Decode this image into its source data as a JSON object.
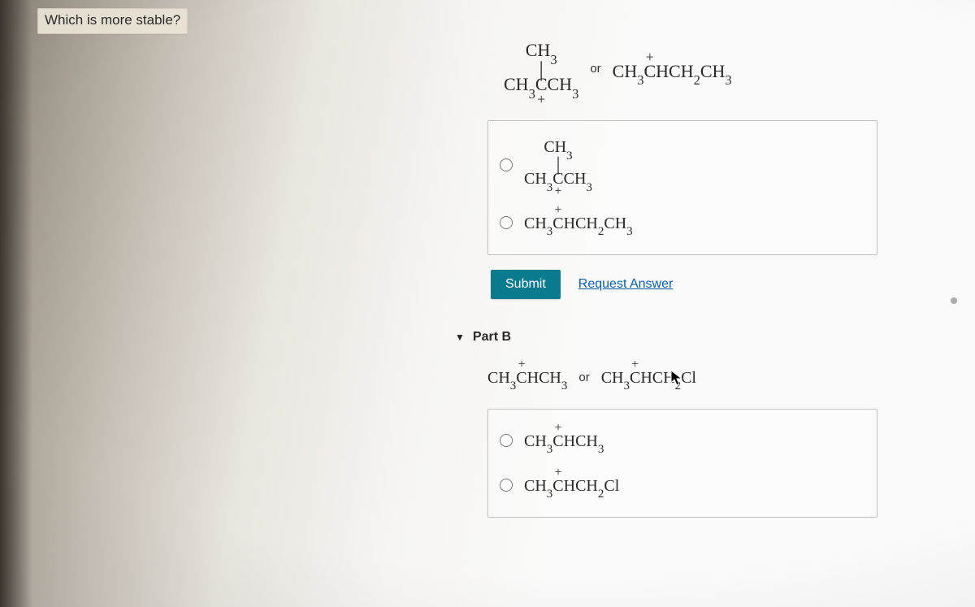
{
  "question": "Which is more stable?",
  "partA": {
    "or": "or",
    "opt1_html": "<span class='stack chem' style='font-size:22px'><span>CH<sub>3</sub></span><span class='bond'>|</span><span>CH<sub>3</sub><span class='under-plus'>C</span>CH<sub>3</sub></span></span>",
    "opt2_html": "<span class='chem' style='font-size:22px'>CH<sub>3</sub><span class='over-plus'>C</span>HCH<sub>2</sub>CH<sub>3</sub></span>",
    "radio1_html": "<span class='stack chem'><span>CH<sub>3</sub></span><span class='bond'>|</span><span>CH<sub>3</sub><span class='under-plus'>C</span>CH<sub>3</sub></span></span>",
    "radio2_html": "<span class='chem'>CH<sub>3</sub><span class='over-plus'>C</span>HCH<sub>2</sub>CH<sub>3</sub></span>",
    "submit": "Submit",
    "request": "Request Answer"
  },
  "partB": {
    "label": "Part B",
    "or": "or",
    "left_html": "<span class='chem'>CH<sub>3</sub><span class='over-plus'>C</span>HCH<sub>3</sub></span>",
    "right_html": "<span class='chem'>CH<sub>3</sub><span class='over-plus'>C</span>HCH<sub>2</sub>Cl</span>",
    "radio1_html": "<span class='chem'>CH<sub>3</sub><span class='over-plus'>C</span>HCH<sub>3</sub></span>",
    "radio2_html": "<span class='chem'>CH<sub>3</sub><span class='over-plus'>C</span>HCH<sub>2</sub>Cl</span>"
  }
}
